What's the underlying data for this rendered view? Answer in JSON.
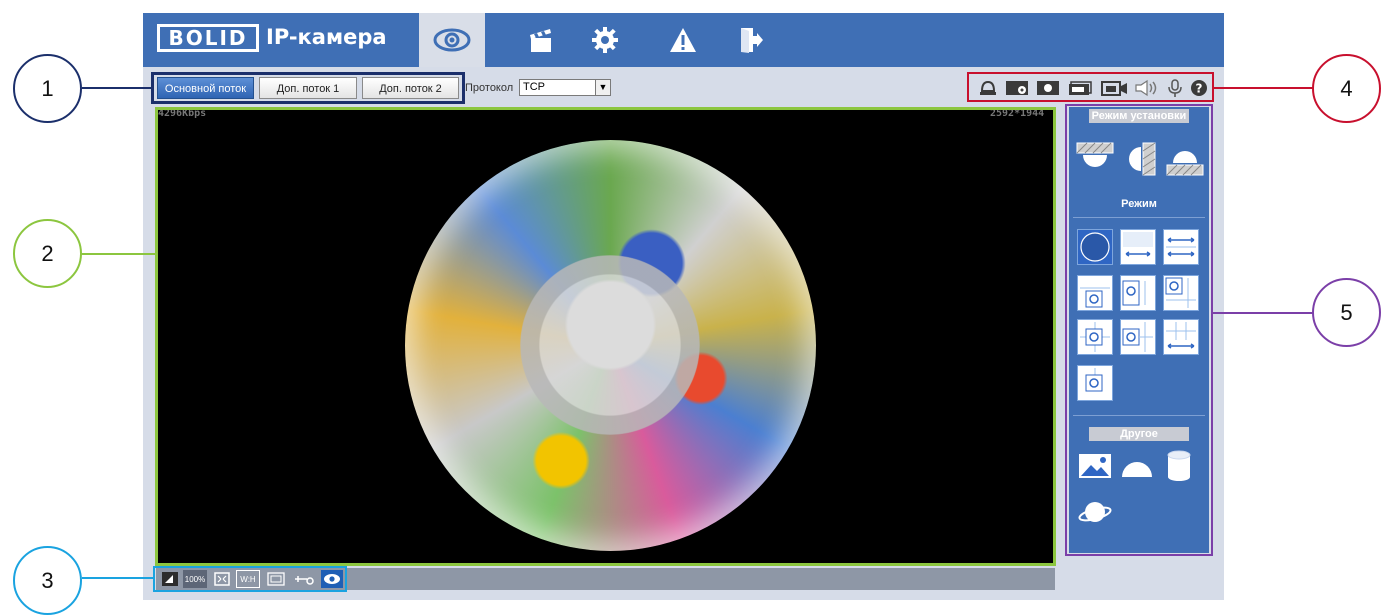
{
  "app": {
    "logo_text": "BOLID",
    "title": "IP-камера",
    "nav_items": [
      {
        "name": "live",
        "icon": "eye-icon"
      },
      {
        "name": "playback",
        "icon": "clapperboard-icon"
      },
      {
        "name": "setup",
        "icon": "gear-icon"
      },
      {
        "name": "alarm",
        "icon": "warning-icon"
      },
      {
        "name": "logout",
        "icon": "exit-icon"
      }
    ]
  },
  "stream": {
    "main_label": "Основной поток",
    "sub1_label": "Доп. поток 1",
    "sub2_label": "Доп. поток 2",
    "protocol_label": "Протокол",
    "protocol_value": "TCP"
  },
  "video": {
    "bitrate": "4296Kbps",
    "resolution": "2592*1944"
  },
  "tools_top": [
    "alarm-bell-icon",
    "zoom-icon",
    "snapshot-icon",
    "triple-snapshot-icon",
    "record-icon",
    "audio-icon",
    "mic-icon",
    "help-icon"
  ],
  "tools_bottom": [
    "fullscreen-left-icon",
    "zoom-100-icon",
    "fit-icon",
    "wh-icon",
    "ratio-icon",
    "ptz-icon",
    "eye-icon"
  ],
  "bottom_labels": {
    "zoom": "100%",
    "wh": "W:H"
  },
  "panel": {
    "install_title": "Режим установки",
    "mode_title": "Режим",
    "other_title": "Другое"
  },
  "callouts": [
    "1",
    "2",
    "3",
    "4",
    "5"
  ],
  "colors": {
    "brand_blue": "#3f6fb5",
    "callout1": "#1b2f6b",
    "callout2": "#8cc63f",
    "callout3": "#1aa3e0",
    "callout4": "#c8102e",
    "callout5": "#7b3fa8"
  }
}
